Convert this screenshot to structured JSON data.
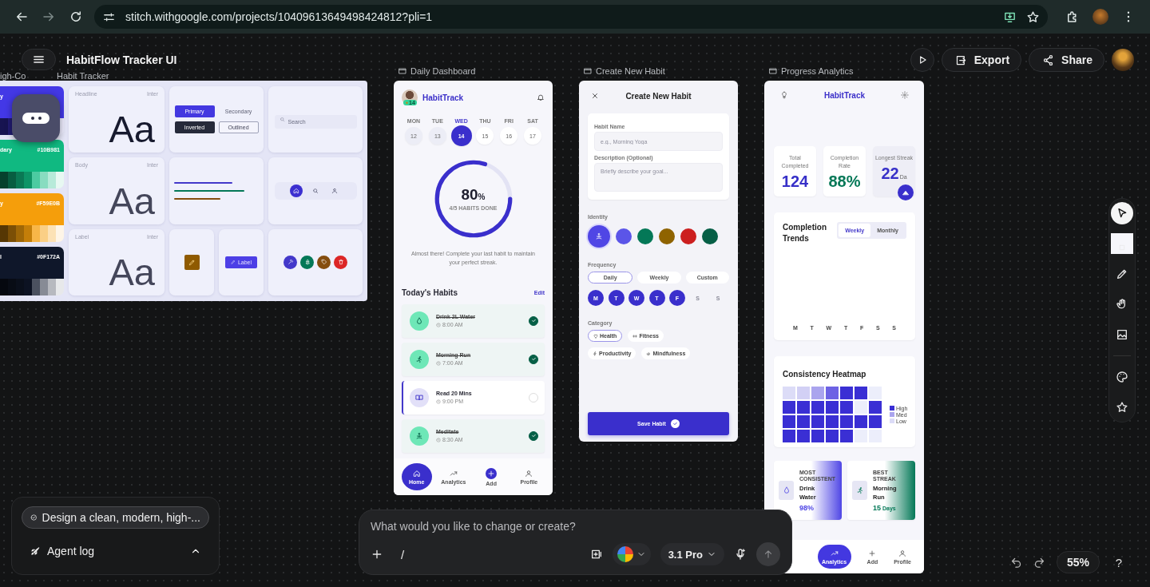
{
  "browser": {
    "url": "stitch.withgoogle.com/projects/10409613649498424812?pli=1"
  },
  "editor": {
    "project_title": "HabitFlow Tracker UI",
    "actions": [
      {
        "label": "Export",
        "kind": "export"
      },
      {
        "label": "Share",
        "kind": "share"
      }
    ],
    "tools": [
      {
        "kind": "select",
        "selected": true
      },
      {
        "kind": "marquee",
        "selected": false
      },
      {
        "kind": "pencil",
        "selected": false
      },
      {
        "kind": "hand",
        "selected": false
      },
      {
        "kind": "image",
        "selected": false
      },
      {
        "kind": "palette",
        "selected": false
      },
      {
        "kind": "star",
        "selected": false
      }
    ],
    "agent": {
      "task": "Design a clean, modern, high-...",
      "log_label": "Agent log"
    },
    "prompt": {
      "placeholder": "What would you like to change or create?",
      "command": "/",
      "model": "3.1 Pro"
    },
    "zoom": "55%",
    "help": "?"
  },
  "design_system": {
    "label_fragments": [
      "igh-Co",
      "Habit Tracker"
    ],
    "colors": [
      {
        "name": "y",
        "color": "#4338e6"
      },
      {
        "name": "dary",
        "hex": "#10B981",
        "color": "#10b981"
      },
      {
        "name": "y",
        "hex": "#F59E0B",
        "color": "#f59e0b"
      },
      {
        "name": "l",
        "hex": "#0F172A",
        "color": "#0f172a"
      }
    ],
    "typography": [
      {
        "role": "Headline",
        "font": "Inter",
        "sample": "Aa"
      },
      {
        "role": "Body",
        "font": "Inter",
        "sample": "Aa"
      },
      {
        "role": "Label",
        "font": "Inter",
        "sample": "Aa"
      }
    ],
    "buttons": [
      {
        "label": "Primary",
        "kind": "primary"
      },
      {
        "label": "Secondary",
        "kind": "secondary"
      },
      {
        "label": "Inverted",
        "kind": "inverted"
      },
      {
        "label": "Outlined",
        "kind": "outlined"
      }
    ],
    "search": {
      "placeholder": "Search"
    },
    "lines": [
      {
        "color": "#4338ca"
      },
      {
        "color": "#047857"
      },
      {
        "color": "#854d0e"
      }
    ],
    "nav_sample": [
      {
        "kind": "home",
        "selected": true
      },
      {
        "kind": "search",
        "selected": false
      },
      {
        "kind": "user",
        "selected": false
      }
    ],
    "chip": {
      "label": "Label"
    },
    "icon_circles": [
      {
        "kind": "tools",
        "color": "#4338ca"
      },
      {
        "kind": "tree",
        "color": "#047857"
      },
      {
        "kind": "tag",
        "color": "#854d0e"
      },
      {
        "kind": "trash",
        "color": "#dc2626"
      }
    ]
  },
  "daily_dashboard": {
    "label": "Daily Dashboard",
    "brand": "HabitTrack",
    "streak": "14",
    "days": [
      {
        "day": "MON",
        "date": "12",
        "selected": false,
        "past": true
      },
      {
        "day": "TUE",
        "date": "13",
        "selected": false,
        "past": true
      },
      {
        "day": "WED",
        "date": "14",
        "selected": true,
        "past": false
      },
      {
        "day": "THU",
        "date": "15",
        "selected": false,
        "past": false
      },
      {
        "day": "FRI",
        "date": "16",
        "selected": false,
        "past": false
      },
      {
        "day": "SAT",
        "date": "17",
        "selected": false,
        "past": false
      }
    ],
    "progress": {
      "value": "80",
      "unit": "%",
      "caption": "4/5 HABITS DONE"
    },
    "message": "Almost there! Complete your last habit to maintain your perfect streak.",
    "habits_title": "Today's Habits",
    "edit": "Edit",
    "habits": [
      {
        "name": "Drink 2L Water",
        "time": "8:00 AM",
        "kind": "water",
        "checked": true
      },
      {
        "name": "Morning Run",
        "time": "7:00 AM",
        "kind": "run",
        "checked": true
      },
      {
        "name": "Read 20 Mins",
        "time": "9:00 PM",
        "kind": "book",
        "checked": false
      },
      {
        "name": "Meditate",
        "time": "8:30 AM",
        "kind": "meditate",
        "checked": true
      }
    ],
    "nav": [
      {
        "label": "Home",
        "kind": "home",
        "selected": true
      },
      {
        "label": "Analytics",
        "kind": "analytics",
        "selected": false
      },
      {
        "label": "Add",
        "kind": "add",
        "selected": false
      },
      {
        "label": "Profile",
        "kind": "profile",
        "selected": false
      }
    ]
  },
  "create_habit": {
    "label": "Create New Habit",
    "title": "Create New Habit",
    "fields": [
      {
        "label": "Habit Name",
        "placeholder": "e.g., Morning Yoga",
        "kind": "input"
      },
      {
        "label": "Description (Optional)",
        "placeholder": "Briefly describe your goal...",
        "kind": "textarea"
      }
    ],
    "identity_label": "Identity",
    "identity_colors": [
      {
        "color": "#5046e5",
        "selected": true
      },
      {
        "color": "#5b55e8",
        "selected": false
      },
      {
        "color": "#047857",
        "selected": false
      },
      {
        "color": "#8f6300",
        "selected": false
      },
      {
        "color": "#cc1f1f",
        "selected": false
      },
      {
        "color": "#065f46",
        "selected": false
      }
    ],
    "frequency_label": "Frequency",
    "frequency": [
      {
        "label": "Daily",
        "selected": true
      },
      {
        "label": "Weekly",
        "selected": false
      },
      {
        "label": "Custom",
        "selected": false
      }
    ],
    "weekdays": [
      {
        "label": "M",
        "selected": true
      },
      {
        "label": "T",
        "selected": true
      },
      {
        "label": "W",
        "selected": true
      },
      {
        "label": "T",
        "selected": true
      },
      {
        "label": "F",
        "selected": true
      },
      {
        "label": "S",
        "selected": false
      },
      {
        "label": "S",
        "selected": false
      }
    ],
    "category_label": "Category",
    "categories": [
      {
        "label": "Health",
        "kind": "heart",
        "selected": true
      },
      {
        "label": "Fitness",
        "kind": "dumbbell",
        "selected": false
      },
      {
        "label": "Productivity",
        "kind": "bolt",
        "selected": false
      },
      {
        "label": "Mindfulness",
        "kind": "spiral",
        "selected": false
      }
    ],
    "save": "Save Habit"
  },
  "progress_analytics": {
    "label": "Progress Analytics",
    "brand": "HabitTrack",
    "stats": [
      {
        "label": "Total Completed",
        "value": "124",
        "color": "#3730c8"
      },
      {
        "label": "Completion Rate",
        "value": "88%",
        "color": "#047857"
      },
      {
        "label": "Longest Streak",
        "value": "22",
        "unit": "Da",
        "color": "#3730c8"
      }
    ],
    "trends": {
      "title": "Completion Trends",
      "toggle": [
        {
          "label": "Weekly",
          "selected": true
        },
        {
          "label": "Monthly",
          "selected": false
        }
      ],
      "days": [
        "M",
        "T",
        "W",
        "T",
        "F",
        "S",
        "S"
      ]
    },
    "heatmap": {
      "title": "Consistency Heatmap",
      "rows": [
        [
          {
            "color": "#dcdcf7"
          },
          {
            "color": "#d2d0f5"
          },
          {
            "color": "#aaa4ee"
          },
          {
            "color": "#6d62e4"
          },
          {
            "color": "#3a2fd4"
          },
          {
            "color": "#3a2fd4"
          },
          {
            "color": "#eceefb"
          }
        ],
        [
          {
            "color": "#3a2fd4"
          },
          {
            "color": "#3a2fd4"
          },
          {
            "color": "#3a2fd4"
          },
          {
            "color": "#3a2fd4"
          },
          {
            "color": "#3a2fd4"
          },
          {
            "color": "#eceefb"
          },
          {
            "color": "#3a2fd4"
          }
        ],
        [
          {
            "color": "#3a2fd4"
          },
          {
            "color": "#3a2fd4"
          },
          {
            "color": "#3a2fd4"
          },
          {
            "color": "#3a2fd4"
          },
          {
            "color": "#3a2fd4"
          },
          {
            "color": "#3a2fd4"
          },
          {
            "color": "#3a2fd4"
          }
        ],
        [
          {
            "color": "#3a2fd4"
          },
          {
            "color": "#3a2fd4"
          },
          {
            "color": "#3a2fd4"
          },
          {
            "color": "#3a2fd4"
          },
          {
            "color": "#3a2fd4"
          },
          {
            "color": "#eceefb"
          },
          {
            "color": "#eceefb"
          }
        ]
      ],
      "legend": [
        {
          "label": "High",
          "color": "#3a2fd4"
        },
        {
          "label": "Med",
          "color": "#aaa4ee"
        },
        {
          "label": "Low",
          "color": "#dcdcf7"
        }
      ]
    },
    "highlights": [
      {
        "caption": "MOST CONSISTENT",
        "name": "Drink Water",
        "value": "98%",
        "kind": "water",
        "color": "#4f46e5"
      },
      {
        "caption": "BEST STREAK",
        "name": "Morning Run",
        "value": "15",
        "unit": "Days",
        "kind": "run",
        "color": "#047857"
      }
    ],
    "nav": [
      {
        "label": "Analytics",
        "kind": "analytics",
        "selected": true
      },
      {
        "label": "Add",
        "kind": "add",
        "selected": false
      },
      {
        "label": "Profile",
        "kind": "profile",
        "selected": false
      }
    ]
  }
}
